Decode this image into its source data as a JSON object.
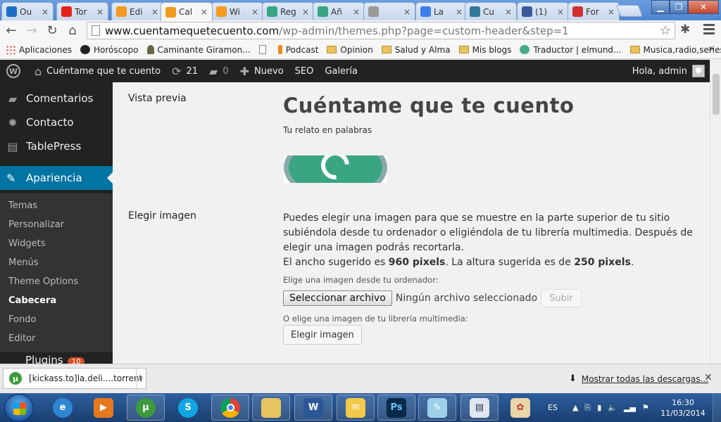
{
  "browser": {
    "tabs": [
      {
        "label": "Ou",
        "icon": "outlook-icon",
        "color": "#1a6fc4"
      },
      {
        "label": "Tor",
        "icon": "youtube-icon",
        "color": "#e62117"
      },
      {
        "label": "Edi",
        "icon": "blogger-icon",
        "color": "#f29a1f"
      },
      {
        "label": "Cal",
        "icon": "blogger-icon",
        "color": "#f29a1f"
      },
      {
        "label": "Wi",
        "icon": "blogger-icon",
        "color": "#f29a1f"
      },
      {
        "label": "Reg",
        "icon": "wordpress-icon",
        "color": "#3aa583"
      },
      {
        "label": "Añ",
        "icon": "wordpress-icon",
        "color": "#3aa583"
      },
      {
        "label": "",
        "icon": "page-icon",
        "color": "#999999"
      },
      {
        "label": "La",
        "icon": "google-icon",
        "color": "#3d7ee8"
      },
      {
        "label": "Cu",
        "icon": "pinwheel-icon",
        "color": "#2f7a9a"
      },
      {
        "label": "(1)",
        "icon": "facebook-icon",
        "color": "#3b5998"
      },
      {
        "label": "For",
        "icon": "web-icon",
        "color": "#d0312d"
      }
    ],
    "url_host": "www.cuentamequetecuento.com",
    "url_path": "/wp-admin/themes.php?page=custom-header&step=1",
    "bookmarks": [
      {
        "label": "Aplicaciones",
        "icon": "grid"
      },
      {
        "label": "Horóscopo",
        "icon": "dark"
      },
      {
        "label": "Caminante Giramon...",
        "icon": "person"
      },
      {
        "label": "",
        "icon": "page"
      },
      {
        "label": "Podcast",
        "icon": "orange"
      },
      {
        "label": "Opinion",
        "icon": "folder"
      },
      {
        "label": "Salud y Alma",
        "icon": "folder"
      },
      {
        "label": "Mis blogs",
        "icon": "folder"
      },
      {
        "label": "Traductor | elmund...",
        "icon": "trad"
      },
      {
        "label": "Musica,radio,series",
        "icon": "folder"
      }
    ],
    "bookmarks_more": "»"
  },
  "adminbar": {
    "site_name": "Cuéntame que te cuento",
    "updates": "21",
    "comments": "0",
    "new_label": "Nuevo",
    "seo_label": "SEO",
    "gallery_label": "Galería",
    "greeting": "Hola, admin"
  },
  "sidebar": {
    "items": [
      {
        "label": "Comentarios",
        "icon": "comment-icon",
        "glyph": "▰"
      },
      {
        "label": "Contacto",
        "icon": "gear-icon",
        "glyph": "✹"
      },
      {
        "label": "TablePress",
        "icon": "table-icon",
        "glyph": "▤"
      }
    ],
    "active": {
      "label": "Apariencia",
      "icon": "brush-icon",
      "glyph": "✎"
    },
    "submenu": [
      "Temas",
      "Personalizar",
      "Widgets",
      "Menús",
      "Theme Options",
      "Cabecera",
      "Fondo",
      "Editor"
    ],
    "current_submenu": "Cabecera",
    "plugins_label": "Plugins",
    "plugins_badge": "10"
  },
  "main": {
    "preview_label": "Vista previa",
    "site_title": "Cuéntame que te cuento",
    "tagline": "Tu relato en palabras",
    "choose_label": "Elegir imagen",
    "desc_line1": "Puedes elegir una imagen para que se muestre en la parte superior de tu sitio subiéndola desde tu ordenador o eligiéndola de tu librería multimedia. Después de elegir una imagen podrás recortarla.",
    "desc_width_pre": "El ancho sugerido es ",
    "desc_width": "960 pixels",
    "desc_height_pre": ". La altura sugerida es de ",
    "desc_height": "250 pixels",
    "desc_end": ".",
    "from_computer": "Elige una imagen desde tu ordenador:",
    "select_file": "Seleccionar archivo",
    "no_file": "Ningún archivo seleccionado",
    "upload": "Subir",
    "from_library": "O elige una imagen de tu librería multimedia:",
    "choose_button": "Elegir imagen"
  },
  "downloads": {
    "file": "[kickass.to]la.deli....torrent",
    "show_all": "Mostrar todas las descargas..."
  },
  "taskbar": {
    "lang": "ES",
    "time": "16:30",
    "date": "11/03/2014"
  }
}
